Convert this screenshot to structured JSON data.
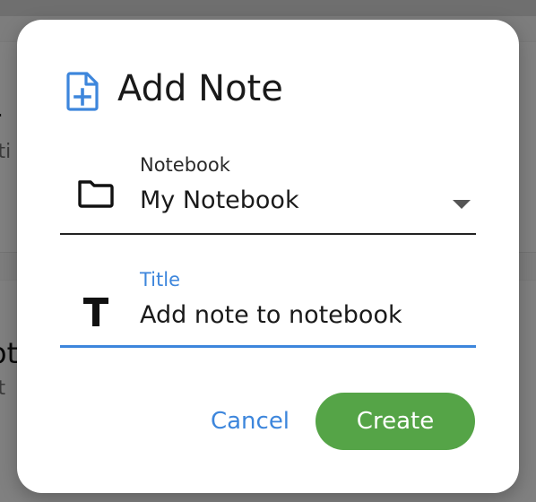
{
  "background": {
    "card1": {
      "title_fragment": "r",
      "subtitle_fragment": "sti"
    },
    "card2": {
      "title_fragment": "ot",
      "subtitle_fragment": "st"
    }
  },
  "dialog": {
    "title": "Add Note",
    "title_icon": "note-add-icon",
    "notebook": {
      "icon": "folder-icon",
      "label": "Notebook",
      "value": "My Notebook"
    },
    "title_field": {
      "icon": "text-format-icon",
      "label": "Title",
      "value": "Add note to notebook"
    },
    "actions": {
      "cancel_label": "Cancel",
      "create_label": "Create"
    }
  },
  "colors": {
    "accent": "#3d86dc",
    "create_button": "#55a447",
    "scrim": "#7f7f7f"
  }
}
